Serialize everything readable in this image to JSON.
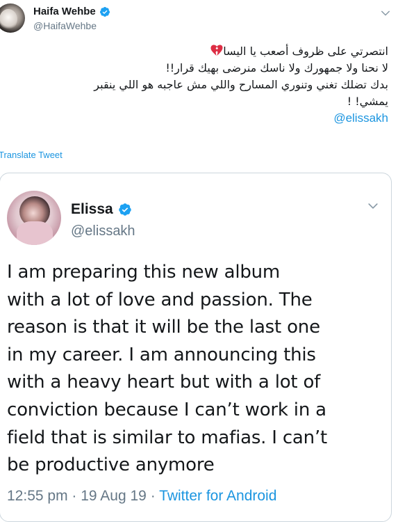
{
  "tweet": {
    "author_name": "Haifa Wehbe",
    "author_handle": "@HaifaWehbe",
    "lines": [
      "انتصرتي على ظروف أصعب يا اليسا",
      "لا نحنا ولا جمهورك ولا ناسك منرضى بهيك قرار!!",
      "بدك تضلك تغني وتنوري المسارح  واللي مش عاجبه هو اللي ينقبر",
      "يمشي! !"
    ],
    "mention": "@elissakh",
    "translate_label": "Translate Tweet"
  },
  "quoted": {
    "author_name": "Elissa",
    "author_handle": "@elissakh",
    "lines": [
      "I am preparing this new album",
      "with a lot of love and passion. The",
      "reason is that it will be the last one",
      "in my career. I am announcing this",
      "with a heavy heart but with a lot of",
      "conviction because I can’t work in a",
      "field that is similar to mafias. I can’t",
      "be productive anymore"
    ],
    "time": "12:55 pm",
    "date": "19 Aug 19",
    "separator": "·",
    "source": "Twitter for Android"
  },
  "icons": {
    "verified": "verified-badge-icon",
    "broken_heart": "broken-heart-icon",
    "more": "chevron-down-icon"
  },
  "colors": {
    "link": "#1b95e0",
    "secondary_text": "#657786",
    "border": "#ccd6dd",
    "broken_heart": "#dd2e44"
  }
}
